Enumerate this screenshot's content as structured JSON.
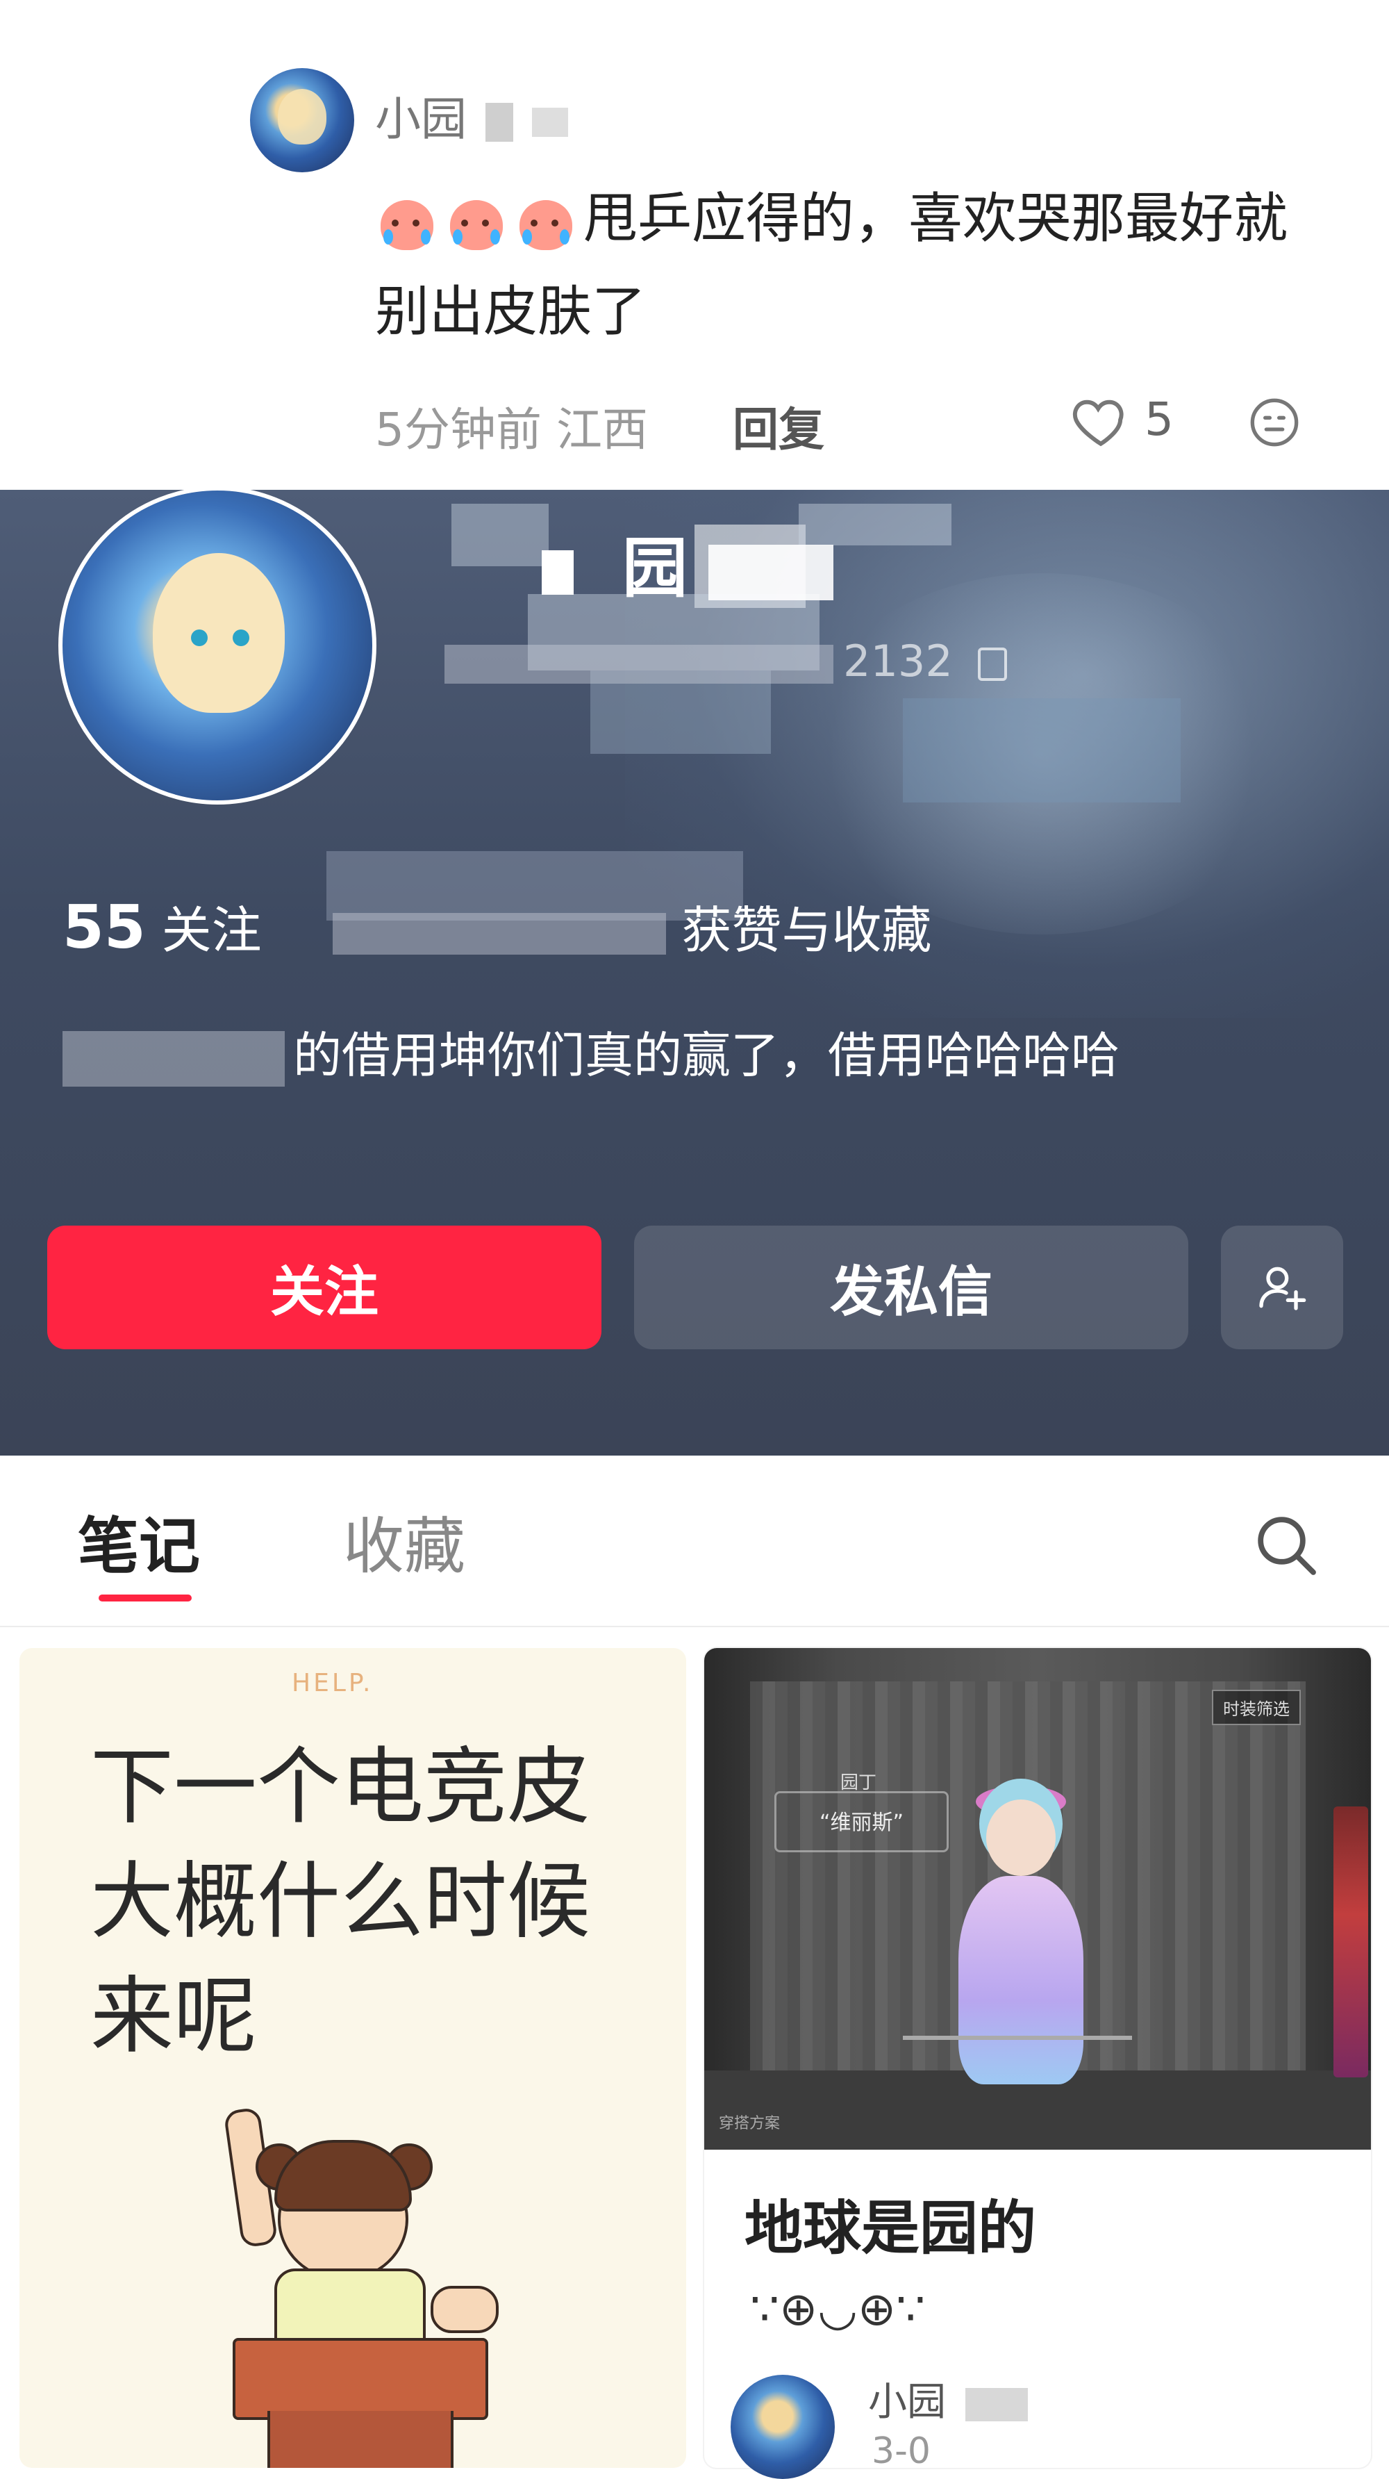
{
  "comment": {
    "username": "小园",
    "text": "甩乒应得的，喜欢哭那最好就别出皮肤了",
    "meta": "5分钟前 江西",
    "reply_label": "回复",
    "like_count": "5",
    "icons": [
      "crying-emoji",
      "heart-outline-icon",
      "smile-icon"
    ]
  },
  "profile": {
    "name": "园",
    "id_text": "2132",
    "stats_following_count": "55",
    "stats_following_label": "关注",
    "stats_likes_label": "获赞与收藏",
    "bio": "的借用坤你们真的赢了，借用哈哈哈哈",
    "follow_button": "关注",
    "message_button": "发私信",
    "add_friend_icon": "add-person-icon"
  },
  "tabs": {
    "notes": "笔记",
    "favorites": "收藏",
    "search_icon": "search-icon"
  },
  "cards": {
    "left": {
      "badge": "HELP.",
      "text": "下一个电竞皮大概什么时候来呢"
    },
    "right": {
      "game_label_top": "园丁",
      "game_label_name": "“维丽斯”",
      "game_tag": "时装筛选",
      "game_bottom": "穿搭方案",
      "title": "地球是园的",
      "kaomoji": "∵⊕◡⊕∵",
      "author": "小园",
      "time": "3-0"
    }
  },
  "colors": {
    "accent": "#ff2442",
    "profile_bg": "#434e66"
  }
}
